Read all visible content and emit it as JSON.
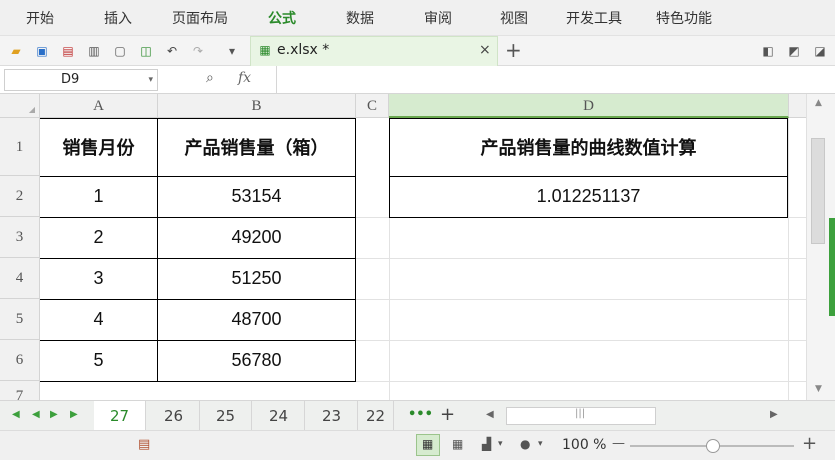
{
  "menu": {
    "items": [
      "开始",
      "插入",
      "页面布局",
      "公式",
      "数据",
      "审阅",
      "视图",
      "开发工具",
      "特色功能"
    ],
    "active": "公式"
  },
  "toolbar": {
    "file_tab_label": "e.xlsx *",
    "close_label": "×",
    "new_tab_label": "+"
  },
  "formula_bar": {
    "name_box_value": "D9",
    "fx_label": "fx",
    "formula_value": ""
  },
  "columns": [
    "A",
    "B",
    "C",
    "D"
  ],
  "rows": [
    "1",
    "2",
    "3",
    "4",
    "5",
    "6",
    "7"
  ],
  "table": {
    "headers": [
      "销售月份",
      "产品销售量（箱）"
    ],
    "rows": [
      [
        "1",
        "53154"
      ],
      [
        "2",
        "49200"
      ],
      [
        "3",
        "51250"
      ],
      [
        "4",
        "48700"
      ],
      [
        "5",
        "56780"
      ]
    ]
  },
  "result": {
    "header": "产品销售量的曲线数值计算",
    "value": "1.012251137"
  },
  "sheet_tabs": {
    "tabs": [
      "27",
      "26",
      "25",
      "24",
      "23",
      "22"
    ],
    "active": "27",
    "more_label": "•••",
    "add_label": "+"
  },
  "status": {
    "zoom": "100 %",
    "zoom_minus": "—",
    "zoom_plus": "+"
  },
  "colors": {
    "accent": "#2a8a2a",
    "selected_col_header": "#d6ebcf"
  }
}
